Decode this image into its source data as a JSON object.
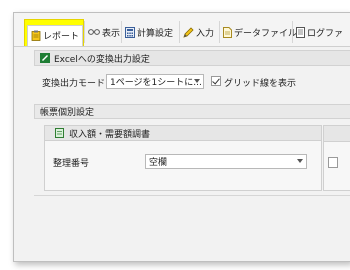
{
  "tabs": [
    {
      "label": "レポート",
      "icon": "clipboard-icon",
      "active": true
    },
    {
      "label": "表示",
      "icon": "glasses-icon"
    },
    {
      "label": "計算設定",
      "icon": "calculator-icon"
    },
    {
      "label": "入力",
      "icon": "pencil-icon"
    },
    {
      "label": "データファイル",
      "icon": "document-icon"
    },
    {
      "label": "ログファ",
      "icon": "log-icon"
    }
  ],
  "excel_section": {
    "title": "Excelへの変換出力設定",
    "mode_label": "変換出力モード",
    "mode_value": "1ページを1シートに...",
    "gridlines_label": "グリッド線を表示",
    "gridlines_checked": true
  },
  "form_section": {
    "title": "帳票個別設定",
    "subpanel_title": "収入額・需要額調書",
    "field_label": "整理番号",
    "field_value": "空欄"
  },
  "colors": {
    "highlight": "#ffff00",
    "excel_green": "#1e7e34",
    "accent_yellow": "#f5c518"
  }
}
